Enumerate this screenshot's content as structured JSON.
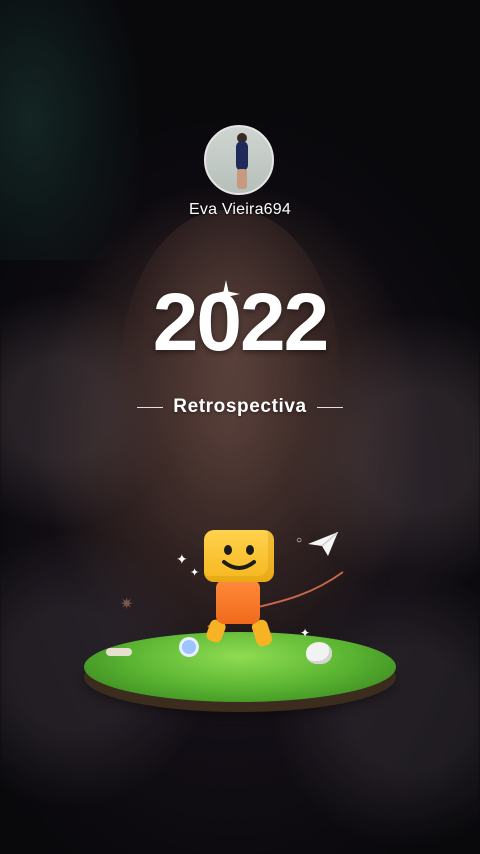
{
  "profile": {
    "username": "Eva Vieira694",
    "avatar_icon": "profile-photo"
  },
  "headline": {
    "year": "2022",
    "subtitle": "Retrospectiva"
  },
  "illustration": {
    "name": "mascot-on-grass-island",
    "colors": {
      "mascot_head": "#f5b61f",
      "mascot_body": "#f06a1b",
      "grass": "#5bb532"
    }
  }
}
